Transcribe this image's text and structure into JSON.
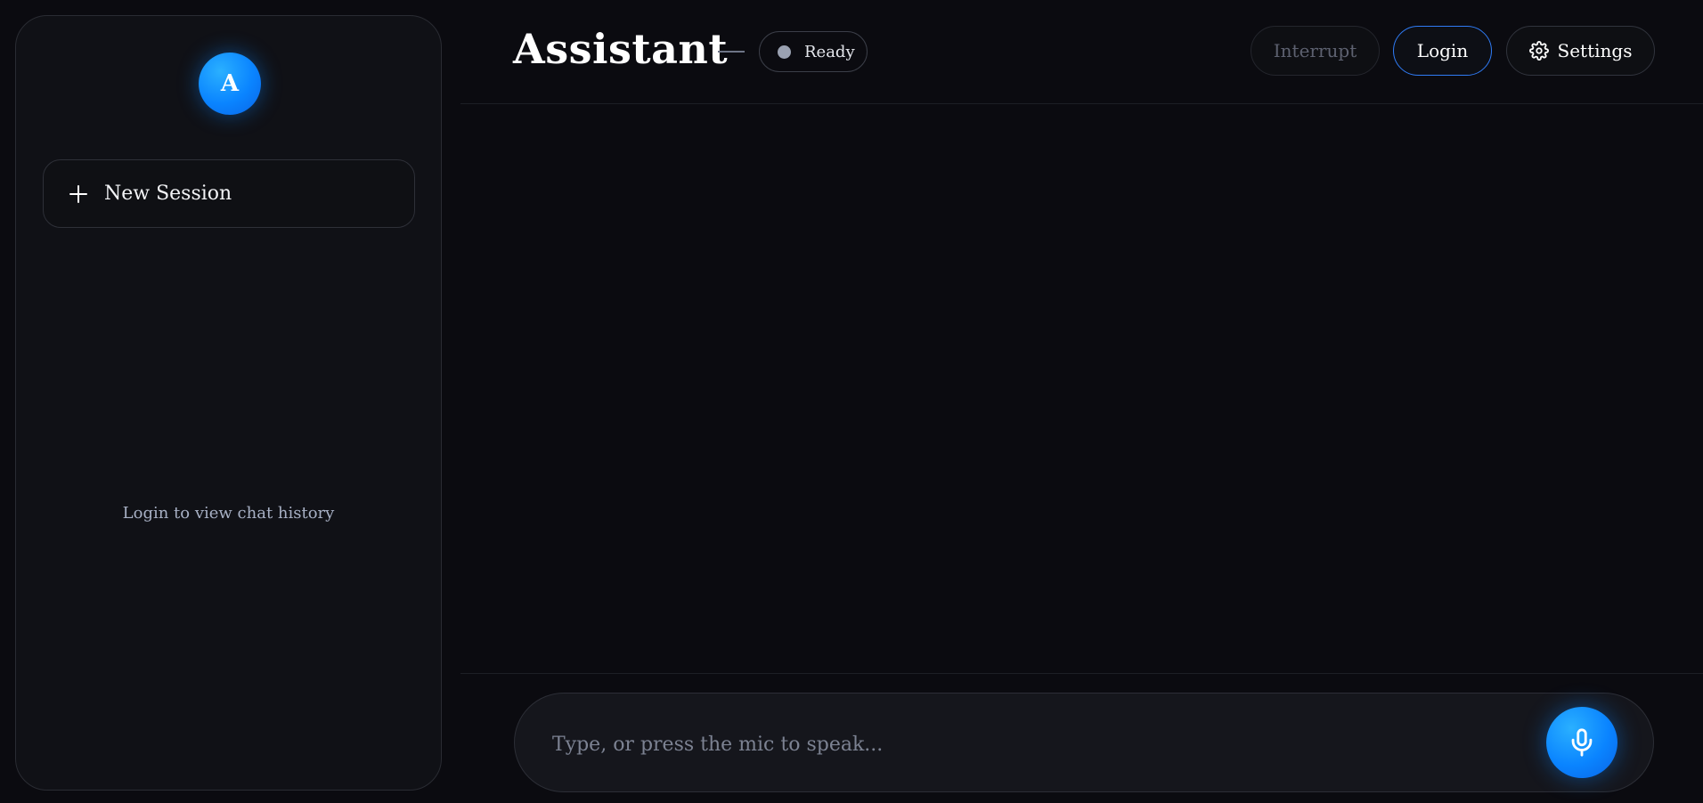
{
  "sidebar": {
    "avatar_letter": "A",
    "new_session_label": "New Session",
    "new_session_icon": "plus-icon",
    "history_hint": "Login to view chat history"
  },
  "header": {
    "title": "Assistant",
    "status": {
      "label": "Ready",
      "dot_color": "#9aa1b1"
    },
    "buttons": {
      "interrupt": "Interrupt",
      "login": "Login",
      "settings": "Settings",
      "settings_icon": "gear-icon"
    }
  },
  "composer": {
    "placeholder": "Type, or press the mic to speak...",
    "value": "",
    "mic_icon": "mic-icon"
  },
  "colors": {
    "accent": "#0a84ff",
    "background": "#0b0b10",
    "login_border": "#2f7bf5"
  }
}
